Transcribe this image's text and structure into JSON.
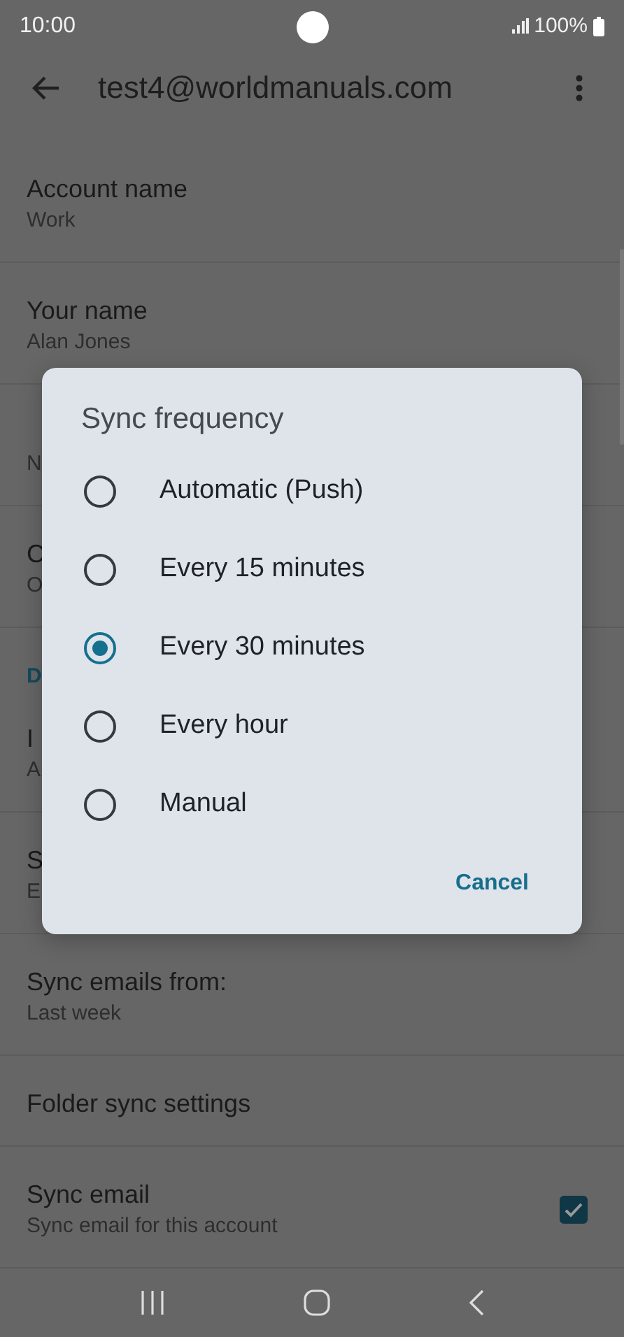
{
  "status_bar": {
    "time": "10:00",
    "battery": "100%"
  },
  "app_bar": {
    "title": "test4@worldmanuals.com"
  },
  "settings": [
    {
      "kind": "item",
      "title": "Account name",
      "subtitle": "Work"
    },
    {
      "kind": "item",
      "title": "Your name",
      "subtitle": "Alan Jones"
    },
    {
      "kind": "item",
      "subtitle": "N"
    },
    {
      "kind": "item",
      "title": "C",
      "subtitle": "O"
    },
    {
      "kind": "header",
      "title": "D"
    },
    {
      "kind": "item",
      "title": "I",
      "subtitle": "A"
    },
    {
      "kind": "item",
      "title": "S",
      "subtitle": "E"
    },
    {
      "kind": "item",
      "title": "Sync emails from:",
      "subtitle": "Last week"
    },
    {
      "kind": "item",
      "title": "Folder sync settings"
    },
    {
      "kind": "checkbox",
      "title": "Sync email",
      "subtitle": "Sync email for this account",
      "checked": true
    }
  ],
  "dialog": {
    "title": "Sync frequency",
    "options": [
      {
        "label": "Automatic (Push)",
        "selected": false
      },
      {
        "label": "Every 15 minutes",
        "selected": false
      },
      {
        "label": "Every 30 minutes",
        "selected": true
      },
      {
        "label": "Every hour",
        "selected": false
      },
      {
        "label": "Manual",
        "selected": false
      }
    ],
    "buttons": [
      "Cancel"
    ]
  }
}
